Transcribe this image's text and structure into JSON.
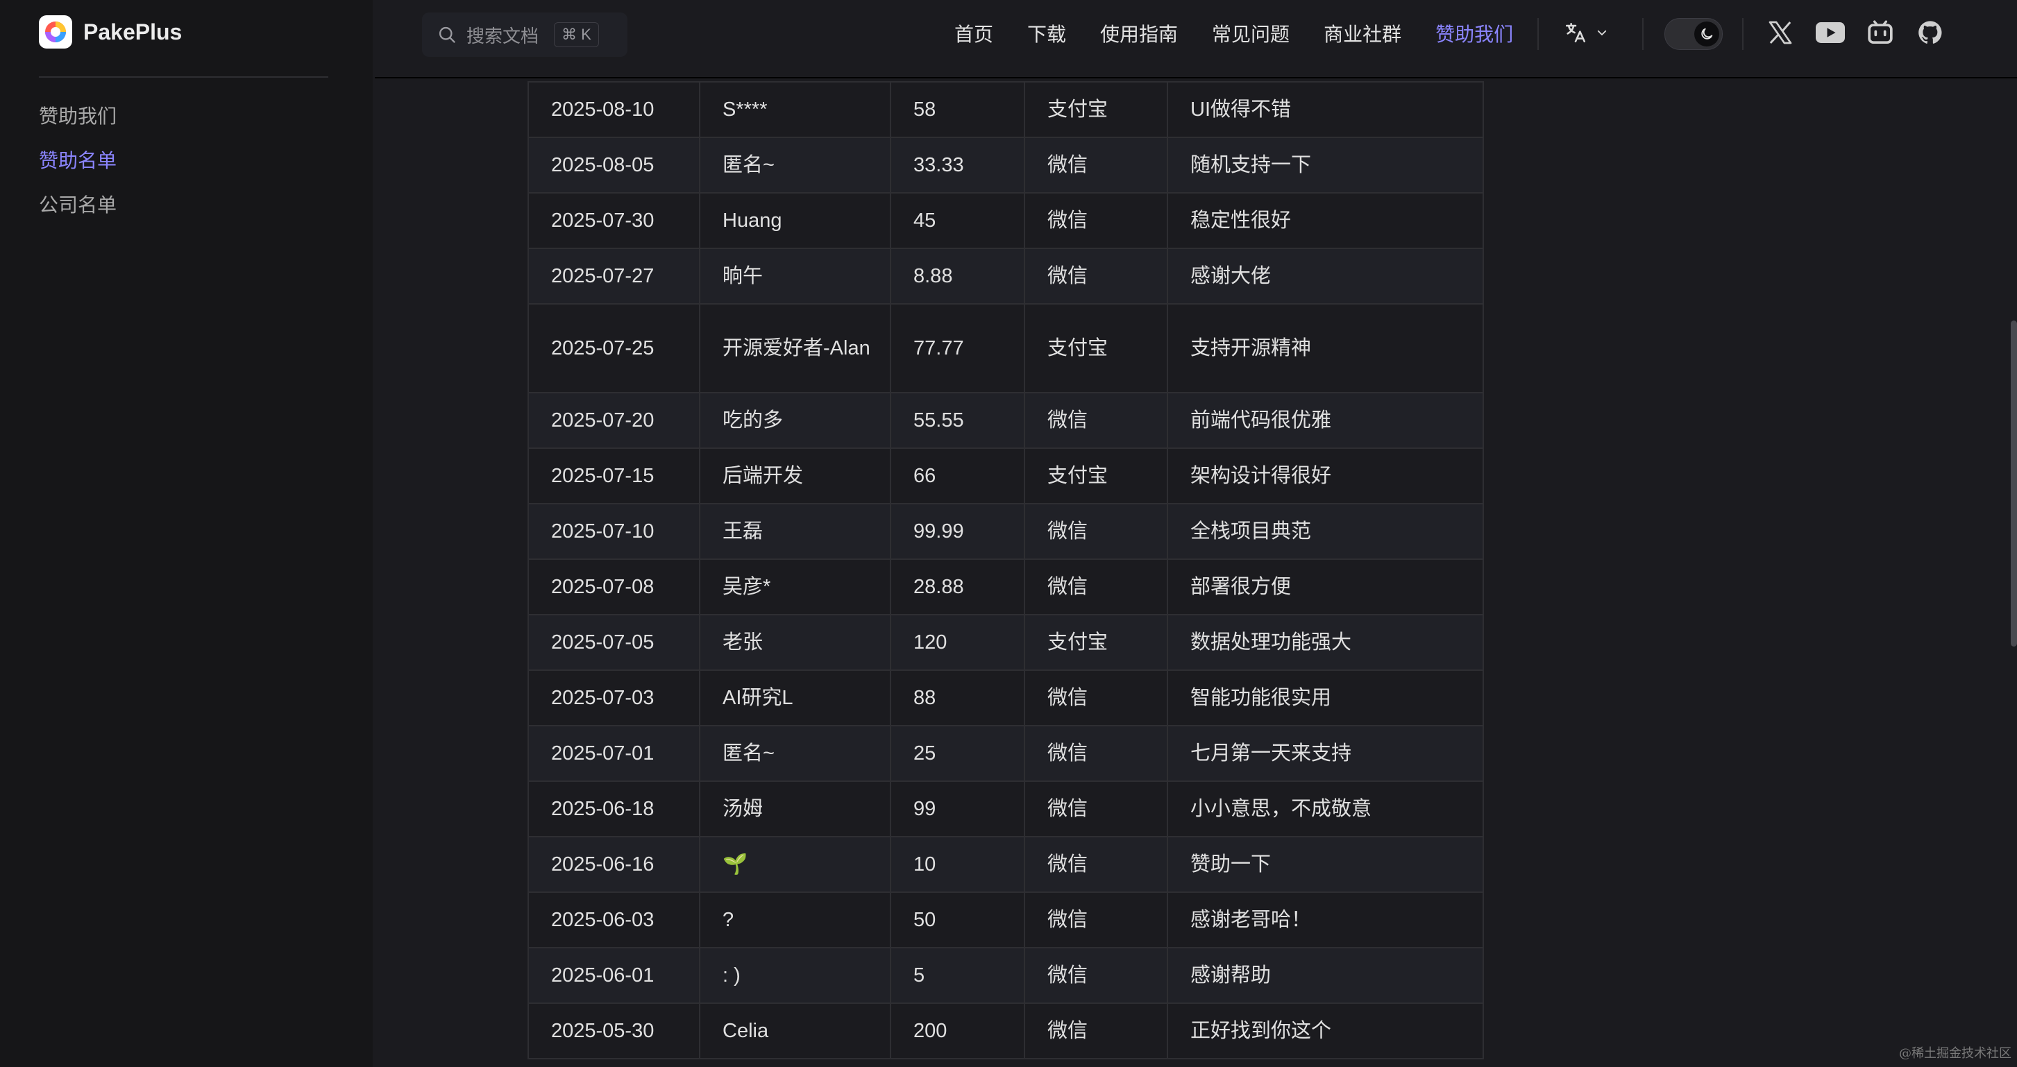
{
  "brand": {
    "name": "PakePlus"
  },
  "sidebar": {
    "items": [
      {
        "label": "赞助我们",
        "active": false
      },
      {
        "label": "赞助名单",
        "active": true
      },
      {
        "label": "公司名单",
        "active": false
      }
    ]
  },
  "search": {
    "placeholder": "搜索文档",
    "shortcut": "⌘ K"
  },
  "nav": {
    "links": [
      {
        "label": "首页"
      },
      {
        "label": "下载"
      },
      {
        "label": "使用指南"
      },
      {
        "label": "常见问题"
      },
      {
        "label": "商业社群"
      },
      {
        "label": "赞助我们",
        "active": true
      }
    ]
  },
  "icons": {
    "lang": "translate-icon",
    "lang_caret": "chevron-down-icon",
    "theme": "moon-icon",
    "socials": [
      "x-icon",
      "youtube-icon",
      "bilibili-icon",
      "github-icon"
    ]
  },
  "colors": {
    "accent": "#8b85ff",
    "background": "#1b1b1f",
    "sidebar": "#161618"
  },
  "table": {
    "rows": [
      [
        "2025-08-10",
        "S****",
        "58",
        "支付宝",
        "UI做得不错"
      ],
      [
        "2025-08-05",
        "匿名~",
        "33.33",
        "微信",
        "随机支持一下"
      ],
      [
        "2025-07-30",
        "Huang",
        "45",
        "微信",
        "稳定性很好"
      ],
      [
        "2025-07-27",
        "晌午",
        "8.88",
        "微信",
        "感谢大佬"
      ],
      [
        "2025-07-25",
        "开源爱好者-Alan",
        "77.77",
        "支付宝",
        "支持开源精神"
      ],
      [
        "2025-07-20",
        "吃的多",
        "55.55",
        "微信",
        "前端代码很优雅"
      ],
      [
        "2025-07-15",
        "后端开发",
        "66",
        "支付宝",
        "架构设计得很好"
      ],
      [
        "2025-07-10",
        "王磊",
        "99.99",
        "微信",
        "全栈项目典范"
      ],
      [
        "2025-07-08",
        "吴彦*",
        "28.88",
        "微信",
        "部署很方便"
      ],
      [
        "2025-07-05",
        "老张",
        "120",
        "支付宝",
        "数据处理功能强大"
      ],
      [
        "2025-07-03",
        "AI研究L",
        "88",
        "微信",
        "智能功能很实用"
      ],
      [
        "2025-07-01",
        "匿名~",
        "25",
        "微信",
        "七月第一天来支持"
      ],
      [
        "2025-06-18",
        "汤姆",
        "99",
        "微信",
        "小小意思，不成敬意"
      ],
      [
        "2025-06-16",
        "🌱",
        "10",
        "微信",
        "赞助一下"
      ],
      [
        "2025-06-03",
        "?",
        "50",
        "微信",
        "感谢老哥哈！"
      ],
      [
        "2025-06-01",
        ": )",
        "5",
        "微信",
        "感谢帮助"
      ],
      [
        "2025-05-30",
        "Celia",
        "200",
        "微信",
        "正好找到你这个"
      ]
    ]
  },
  "watermark": "@稀土掘金技术社区"
}
